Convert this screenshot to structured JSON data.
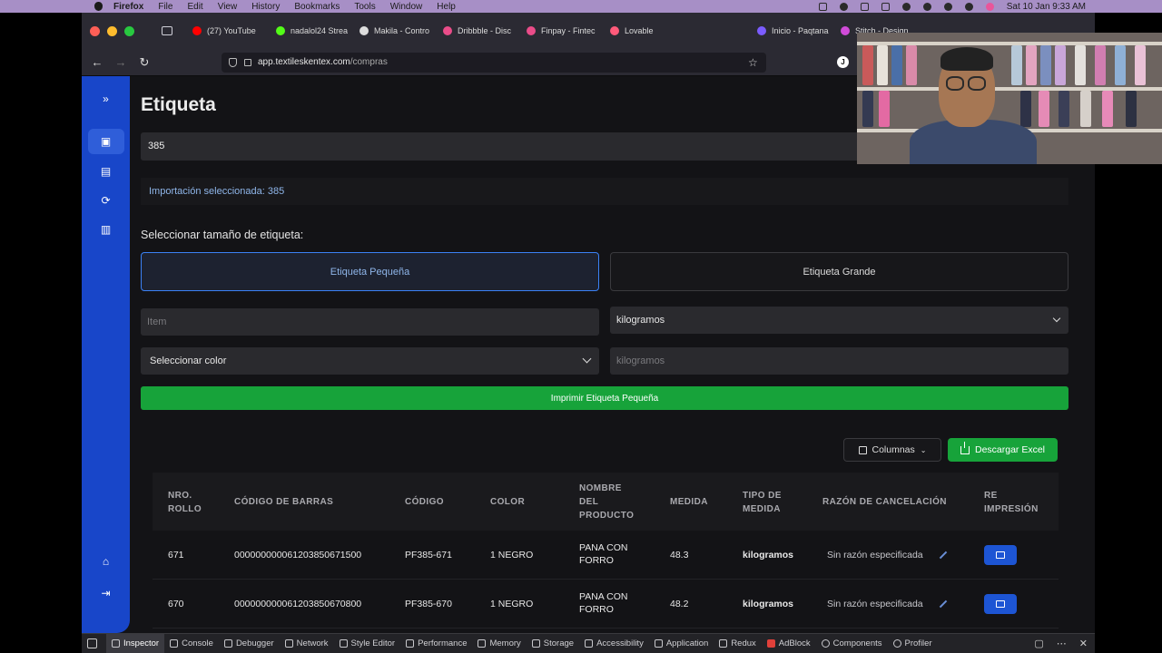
{
  "menubar": {
    "app": "Firefox",
    "items": [
      "File",
      "Edit",
      "View",
      "History",
      "Bookmarks",
      "Tools",
      "Window",
      "Help"
    ],
    "datetime": "Sat 10 Jan  9:33 AM"
  },
  "browser": {
    "tabs": [
      {
        "label": "(27) YouTube",
        "color": "#ff0000"
      },
      {
        "label": "nadalol24 Strea",
        "color": "#53fc18"
      },
      {
        "label": "Makila - Contro",
        "color": "#dddddd"
      },
      {
        "label": "Dribbble - Disc",
        "color": "#ea4c89"
      },
      {
        "label": "Finpay - Fintec",
        "color": "#ea4c89"
      },
      {
        "label": "Lovable",
        "color": "#ff5a7a"
      },
      {
        "label": "Inicio - Paqtana",
        "color": "#7b5cff"
      },
      {
        "label": "Stitch - Design",
        "color": "#d14bd9"
      }
    ],
    "url_host": "app.textileskentex.com",
    "url_path": "/compras",
    "profile_initial": "J"
  },
  "page": {
    "title": "Etiqueta",
    "import_value": "385",
    "import_selected": "Importación seleccionada: 385",
    "size_label": "Seleccionar tamaño de etiqueta:",
    "size_small": "Etiqueta Pequeña",
    "size_big": "Etiqueta Grande",
    "item_placeholder": "Item",
    "unit_select": "kilogramos",
    "color_select": "Seleccionar color",
    "weight_placeholder": "kilogramos",
    "print_button": "Imprimir Etiqueta Pequeña",
    "columns_button": "Columnas",
    "excel_button": "Descargar Excel"
  },
  "table": {
    "headers": [
      [
        "NRO.",
        "ROLLO"
      ],
      [
        "CÓDIGO DE BARRAS"
      ],
      [
        "CÓDIGO"
      ],
      [
        "COLOR"
      ],
      [
        "NOMBRE",
        "DEL",
        "PRODUCTO"
      ],
      [
        "MEDIDA"
      ],
      [
        "TIPO DE",
        "MEDIDA"
      ],
      [
        "RAZÓN DE CANCELACIÓN"
      ],
      [
        "RE",
        "IMPRESIÓN"
      ]
    ],
    "rows": [
      {
        "rollo": "671",
        "barcode": "000000000061203850671500",
        "codigo": "PF385-671",
        "color": "1 NEGRO",
        "producto1": "PANA CON",
        "producto2": "FORRO",
        "medida": "48.3",
        "tipo": "kilogramos",
        "razon": "Sin razón especificada"
      },
      {
        "rollo": "670",
        "barcode": "000000000061203850670800",
        "codigo": "PF385-670",
        "color": "1 NEGRO",
        "producto1": "PANA CON",
        "producto2": "FORRO",
        "medida": "48.2",
        "tipo": "kilogramos",
        "razon": "Sin razón especificada"
      }
    ]
  },
  "devtools": {
    "tabs": [
      "Inspector",
      "Console",
      "Debugger",
      "Network",
      "Style Editor",
      "Performance",
      "Memory",
      "Storage",
      "Accessibility",
      "Application",
      "Redux",
      "AdBlock",
      "Components",
      "Profiler"
    ]
  }
}
